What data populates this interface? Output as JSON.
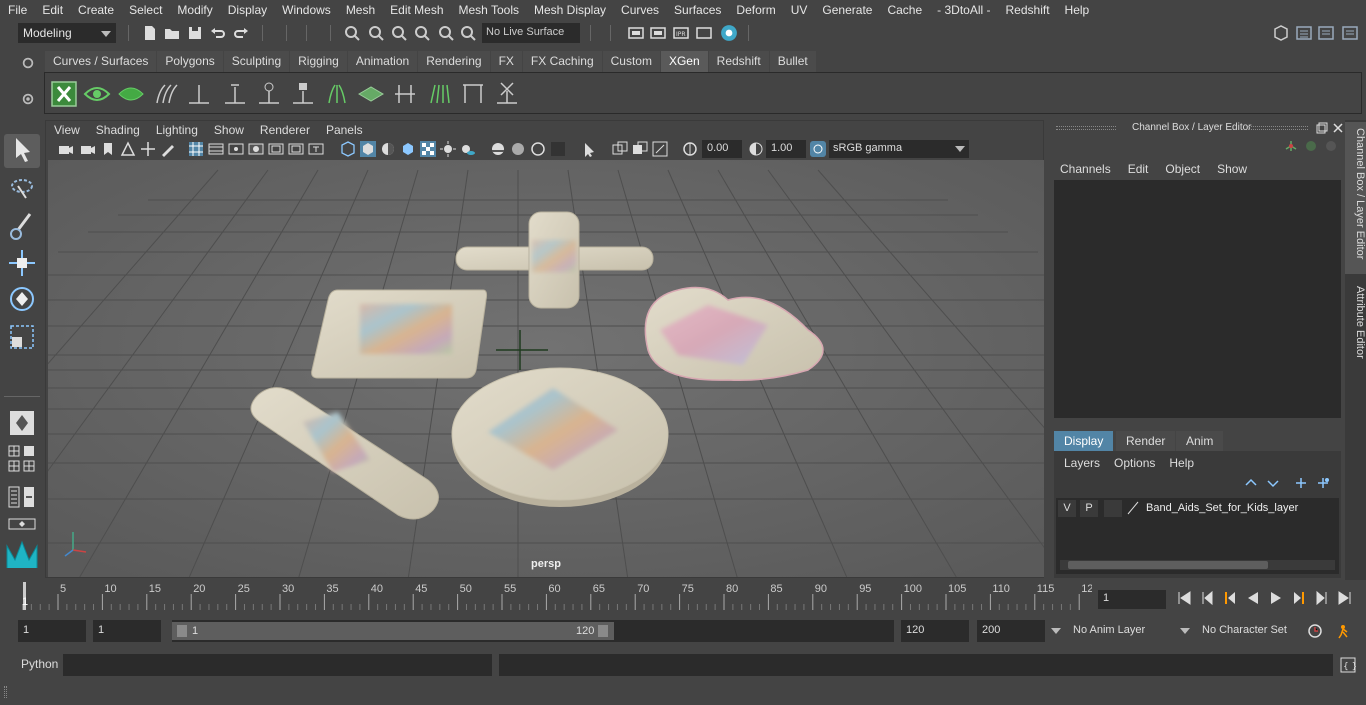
{
  "menubar": [
    "File",
    "Edit",
    "Create",
    "Select",
    "Modify",
    "Display",
    "Windows",
    "Mesh",
    "Edit Mesh",
    "Mesh Tools",
    "Mesh Display",
    "Curves",
    "Surfaces",
    "Deform",
    "UV",
    "Generate",
    "Cache",
    "- 3DtoAll -",
    "Redshift",
    "Help"
  ],
  "status": {
    "mode": "Modeling",
    "live_surface": "No Live Surface"
  },
  "shelf_tabs": [
    "Curves / Surfaces",
    "Polygons",
    "Sculpting",
    "Rigging",
    "Animation",
    "Rendering",
    "FX",
    "FX Caching",
    "Custom",
    "XGen",
    "Redshift",
    "Bullet"
  ],
  "shelf_active": "XGen",
  "panel_menu": [
    "View",
    "Shading",
    "Lighting",
    "Show",
    "Renderer",
    "Panels"
  ],
  "panel_toolbar": {
    "exposure": "0.00",
    "gamma": "1.00",
    "color_space": "sRGB gamma"
  },
  "viewport": {
    "camera_label": "persp"
  },
  "channel_box": {
    "title": "Channel Box / Layer Editor",
    "menu": [
      "Channels",
      "Edit",
      "Object",
      "Show"
    ]
  },
  "layer_editor": {
    "tabs": [
      "Display",
      "Render",
      "Anim"
    ],
    "active_tab": "Display",
    "menu": [
      "Layers",
      "Options",
      "Help"
    ],
    "layer": {
      "v": "V",
      "p": "P",
      "name": "Band_Aids_Set_for_Kids_layer"
    }
  },
  "side_tabs": [
    "Channel Box / Layer Editor",
    "Attribute Editor"
  ],
  "timeline": {
    "ticks": [
      "5",
      "10",
      "15",
      "20",
      "25",
      "30",
      "35",
      "40",
      "45",
      "50",
      "55",
      "60",
      "65",
      "70",
      "75",
      "80",
      "85",
      "90",
      "95",
      "100",
      "105",
      "110",
      "115",
      "12"
    ],
    "start_label": "1",
    "current_frame": "1"
  },
  "range": {
    "start": "1",
    "playback_start": "1",
    "slider_start": "1",
    "slider_end": "120",
    "playback_end": "120",
    "end": "200",
    "anim_layer": "No Anim Layer",
    "character_set": "No Character Set"
  },
  "cmdline": {
    "label": "Python"
  },
  "colors": {
    "bg": "#444444",
    "field": "#2b2b2b",
    "viewport": "#6d6d6d",
    "accent": "#5285a6",
    "active_tab": "#5a5a5a"
  }
}
